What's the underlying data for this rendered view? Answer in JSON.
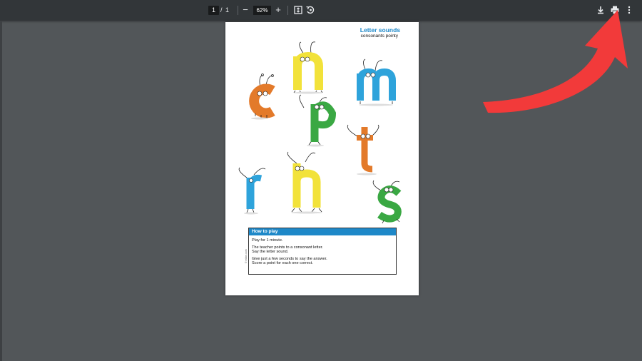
{
  "toolbar": {
    "current_page": "1",
    "page_separator": "/",
    "total_pages": "1",
    "zoom_out_label": "−",
    "zoom_level": "62%",
    "zoom_in_label": "+",
    "icons": [
      "fit-page-icon",
      "rotate-icon",
      "download-icon",
      "print-icon",
      "more-options-icon"
    ]
  },
  "document": {
    "title": "Letter sounds",
    "subtitle": "consonants pointy",
    "letters": [
      "c",
      "n",
      "m",
      "p",
      "t",
      "r",
      "h",
      "s"
    ],
    "letter_colors": {
      "c": "#e37a2a",
      "n": "#f2e23a",
      "m": "#2ea3db",
      "p": "#3aa843",
      "t": "#e37a2a",
      "r": "#2ea3db",
      "h": "#f2e23a",
      "s": "#3aa843"
    },
    "how_to_play": {
      "heading": "How to play",
      "line1": "Play for 1 minute.",
      "line2a": "The teacher points to a consonant letter.",
      "line2b": "Say the letter sound.",
      "line3a": "Give just a few seconds to say the answer.",
      "line3b": "Score a point for each one correct."
    },
    "copyright": "© mbbs.com"
  },
  "colors": {
    "toolbar_bg": "#323639",
    "viewer_bg": "#525659",
    "accent_blue": "#1e88c8",
    "arrow_red": "#f23a3a"
  }
}
